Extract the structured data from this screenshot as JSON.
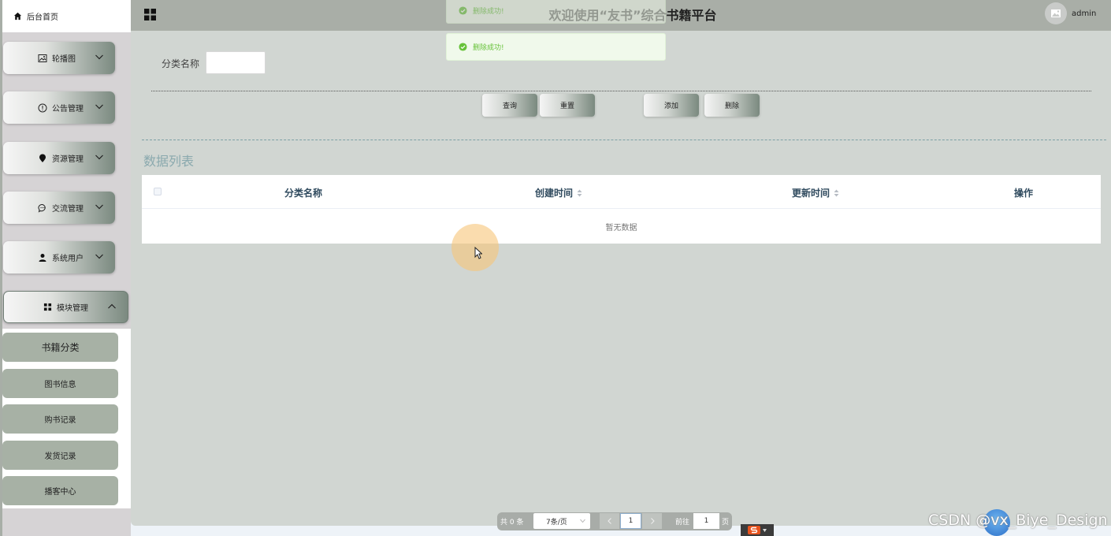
{
  "sidebar": {
    "home": "后台首页",
    "menus": [
      {
        "label": "轮播图",
        "icon": "image-icon"
      },
      {
        "label": "公告管理",
        "icon": "info-circle-icon"
      },
      {
        "label": "资源管理",
        "icon": "location-pin-icon"
      },
      {
        "label": "交流管理",
        "icon": "chat-bubble-icon"
      },
      {
        "label": "系统用户",
        "icon": "user-icon"
      },
      {
        "label": "模块管理",
        "icon": "grid-icon"
      }
    ],
    "submenu": [
      "书籍分类",
      "图书信息",
      "购书记录",
      "发货记录",
      "播客中心"
    ]
  },
  "header": {
    "title": "欢迎使用“友书”综合书籍平台",
    "user": "admin"
  },
  "toasts": [
    "删除成功!",
    "删除成功!"
  ],
  "search": {
    "label": "分类名称",
    "value": ""
  },
  "actions": {
    "query": "查询",
    "reset": "重置",
    "add": "添加",
    "delete": "删除"
  },
  "list": {
    "title": "数据列表",
    "columns": [
      "分类名称",
      "创建时间",
      "更新时间",
      "操作"
    ],
    "empty_text": "暂无数据"
  },
  "pagination": {
    "total": "共 0 条",
    "page_size": "7条/页",
    "current_page": "1",
    "goto_label": "前往",
    "goto_value": "1",
    "page_suffix": "页"
  },
  "watermark": "CSDN @vx_Biye_Design",
  "colors": {
    "success": "#67c23a",
    "header_bg": "#a9aea7",
    "main_bg": "#d1d6d2",
    "submenu_bg": "#a7b1a5",
    "list_title": "#8aa9ae"
  }
}
